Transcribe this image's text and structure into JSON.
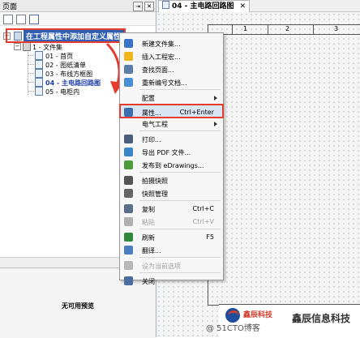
{
  "left_panel": {
    "title": "页面",
    "title_buttons": [
      "⇥",
      "✕"
    ],
    "tree": {
      "root_label": "在工程属性中添加自定义属性",
      "group_label": "1 - 文件集",
      "pages": [
        {
          "label": "01 - 首页",
          "current": false
        },
        {
          "label": "02 - 图纸清单",
          "current": false
        },
        {
          "label": "03 - 布线方框图",
          "current": false
        },
        {
          "label": "04 - 主电路回路图",
          "current": true
        },
        {
          "label": "05 - 电柜内",
          "current": false
        }
      ]
    },
    "preview_text": "无可用预览"
  },
  "document_tab": {
    "title": "04 - 主电路回路图",
    "close_glyph": "✕"
  },
  "ruler": {
    "numbers": [
      "1",
      "2",
      "3"
    ]
  },
  "context_menu": {
    "items": [
      {
        "label": "新建文件集...",
        "shortcut": "",
        "icon": "folder-icon",
        "disabled": false,
        "submenu": false
      },
      {
        "label": "插入工程宏...",
        "shortcut": "",
        "icon": "star-icon",
        "disabled": false,
        "submenu": false
      },
      {
        "label": "查找页面...",
        "shortcut": "",
        "icon": "find-icon",
        "disabled": false,
        "submenu": false
      },
      {
        "label": "重新编号文档...",
        "shortcut": "",
        "icon": "renumber-icon",
        "disabled": false,
        "submenu": false
      },
      {
        "label": "配置",
        "shortcut": "",
        "icon": "",
        "disabled": false,
        "submenu": true
      },
      {
        "label": "属性...",
        "shortcut": "Ctrl+Enter",
        "icon": "properties-icon",
        "disabled": false,
        "submenu": false,
        "highlight": true
      },
      {
        "label": "电气工程",
        "shortcut": "",
        "icon": "",
        "disabled": false,
        "submenu": true
      },
      {
        "label": "打印...",
        "shortcut": "",
        "icon": "print-icon",
        "disabled": false,
        "submenu": false
      },
      {
        "label": "导出 PDF 文件...",
        "shortcut": "",
        "icon": "pdf-icon",
        "disabled": false,
        "submenu": false
      },
      {
        "label": "发布到 eDrawings...",
        "shortcut": "",
        "icon": "edrawings-icon",
        "disabled": false,
        "submenu": false
      },
      {
        "label": "拍摄快照",
        "shortcut": "",
        "icon": "camera-icon",
        "disabled": false,
        "submenu": false
      },
      {
        "label": "快照管理",
        "shortcut": "",
        "icon": "snapshot-icon",
        "disabled": false,
        "submenu": false
      },
      {
        "label": "复制",
        "shortcut": "Ctrl+C",
        "icon": "copy-icon",
        "disabled": false,
        "submenu": false
      },
      {
        "label": "粘贴",
        "shortcut": "Ctrl+V",
        "icon": "paste-icon",
        "disabled": true,
        "submenu": false
      },
      {
        "label": "刷新",
        "shortcut": "F5",
        "icon": "refresh-icon",
        "disabled": false,
        "submenu": false
      },
      {
        "label": "翻译...",
        "shortcut": "",
        "icon": "translate-icon",
        "disabled": false,
        "submenu": false
      },
      {
        "label": "设为当前选项",
        "shortcut": "",
        "icon": "set-current-icon",
        "disabled": true,
        "submenu": false
      },
      {
        "label": "关闭",
        "shortcut": "",
        "icon": "close-doc-icon",
        "disabled": false,
        "submenu": false
      }
    ]
  },
  "title_block": {
    "logo_text": "鑫辰科技",
    "company": "鑫辰信息科技"
  },
  "watermark": "@ 51CTO博客",
  "colors": {
    "highlight_red": "#e63b2e",
    "selection_blue": "#2f5fb3",
    "menu_hover": "#d9e6f5",
    "logo_blue": "#1e4d9a",
    "logo_red": "#d33b2c"
  }
}
